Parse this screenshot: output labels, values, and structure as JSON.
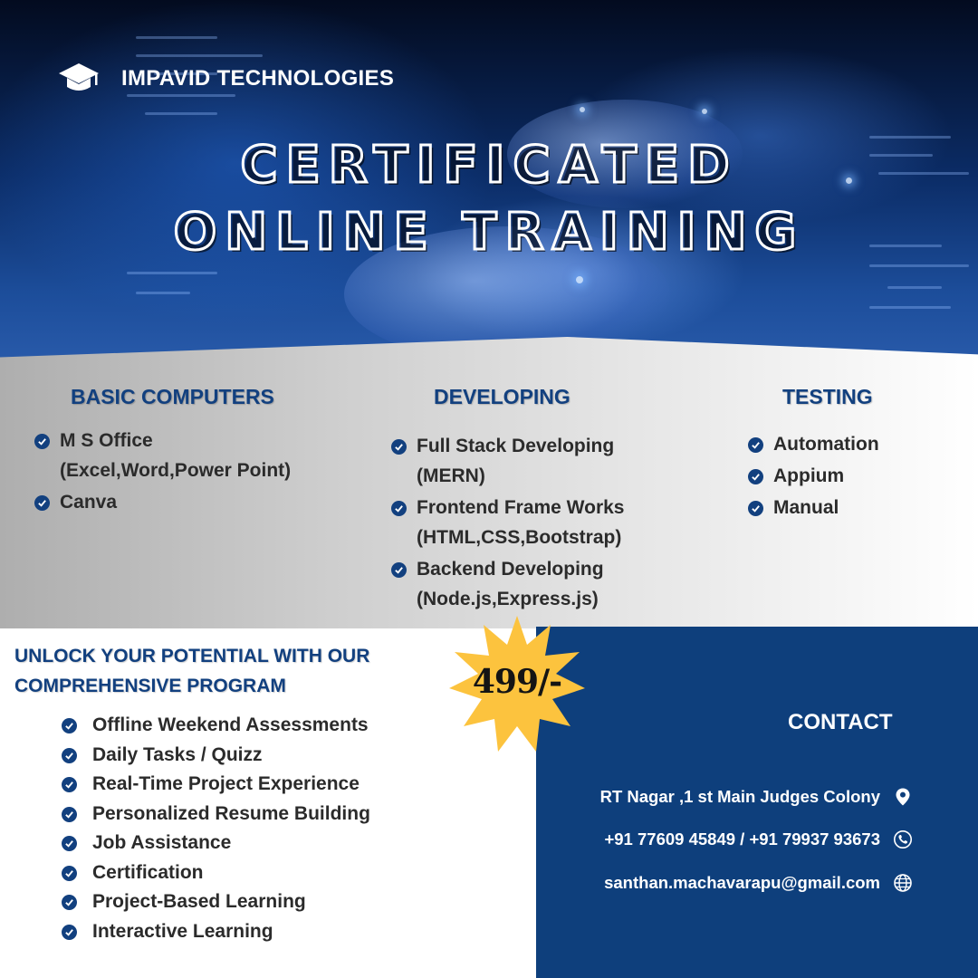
{
  "brand": {
    "name": "IMPAVID TECHNOLOGIES",
    "icon": "graduation-cap-icon"
  },
  "headline": {
    "line1": "CERTIFICATED",
    "line2": "ONLINE TRAINING"
  },
  "courses": [
    {
      "title": "BASIC COMPUTERS",
      "items": [
        {
          "text": "M S Office",
          "sub": "(Excel,Word,Power Point)"
        },
        {
          "text": "Canva",
          "sub": ""
        }
      ]
    },
    {
      "title": "DEVELOPING",
      "items": [
        {
          "text": "Full Stack Developing",
          "sub": "(MERN)"
        },
        {
          "text": "Frontend Frame Works",
          "sub": "(HTML,CSS,Bootstrap)"
        },
        {
          "text": "Backend Developing",
          "sub": "(Node.js,Express.js)"
        }
      ]
    },
    {
      "title": "TESTING",
      "items": [
        {
          "text": "Automation",
          "sub": ""
        },
        {
          "text": "Appium",
          "sub": ""
        },
        {
          "text": "Manual",
          "sub": ""
        }
      ]
    }
  ],
  "program": {
    "heading_line1": "UNLOCK YOUR POTENTIAL WITH OUR",
    "heading_line2": "COMPREHENSIVE PROGRAM",
    "features": [
      "Offline Weekend Assessments",
      "Daily Tasks / Quizz",
      "Real-Time Project Experience",
      "Personalized Resume Building",
      "Job Assistance",
      "Certification",
      "Project-Based Learning",
      "Interactive Learning"
    ]
  },
  "price": "499/-",
  "contact": {
    "title": "CONTACT",
    "address": "RT Nagar ,1 st Main  Judges Colony",
    "phone": "+91 77609 45849 / +91 79937 93673",
    "email": "santhan.machavarapu@gmail.com",
    "icons": [
      "location-pin-icon",
      "phone-icon",
      "globe-icon"
    ]
  },
  "colors": {
    "navy": "#12407f",
    "panel": "#0e3f7c",
    "star": "#fcc33e",
    "text": "#2b2b2b"
  }
}
